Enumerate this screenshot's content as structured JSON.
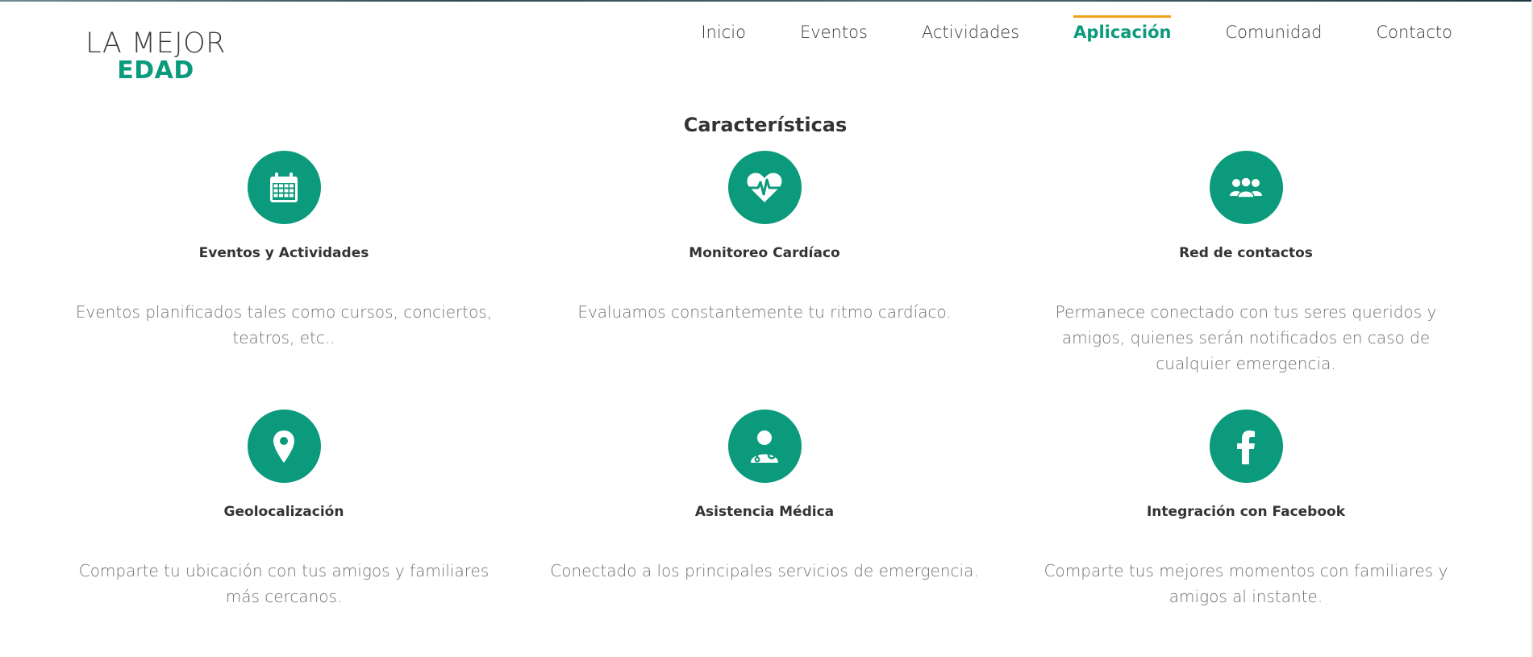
{
  "brand": {
    "line1": "LA MEJOR",
    "line2": "EDAD",
    "accent": "#0b9a7b"
  },
  "nav": {
    "items": [
      {
        "label": "Inicio",
        "active": false
      },
      {
        "label": "Eventos",
        "active": false
      },
      {
        "label": "Actividades",
        "active": false
      },
      {
        "label": "Aplicación",
        "active": true
      },
      {
        "label": "Comunidad",
        "active": false
      },
      {
        "label": "Contacto",
        "active": false
      }
    ],
    "active_color": "#0b9a7b",
    "active_indicator_color": "#f1a01a"
  },
  "section": {
    "title": "Características",
    "features": [
      {
        "icon": "calendar-icon",
        "title": "Eventos y Actividades",
        "description": "Eventos planificados tales como cursos, conciertos, teatros, etc.."
      },
      {
        "icon": "heart-pulse-icon",
        "title": "Monitoreo Cardíaco",
        "description": "Evaluamos constantemente tu ritmo cardíaco."
      },
      {
        "icon": "users-icon",
        "title": "Red de contactos",
        "description": "Permanece conectado con tus seres queridos y amigos, quienes serán notificados en caso de cualquier emergencia."
      },
      {
        "icon": "map-marker-icon",
        "title": "Geolocalización",
        "description": "Comparte tu ubicación con tus amigos y familiares más cercanos."
      },
      {
        "icon": "doctor-icon",
        "title": "Asistencia Médica",
        "description": "Conectado a los principales servicios de emergencia."
      },
      {
        "icon": "facebook-icon",
        "title": "Integración con Facebook",
        "description": "Comparte tus mejores momentos con familiares y amigos al instante."
      }
    ]
  }
}
